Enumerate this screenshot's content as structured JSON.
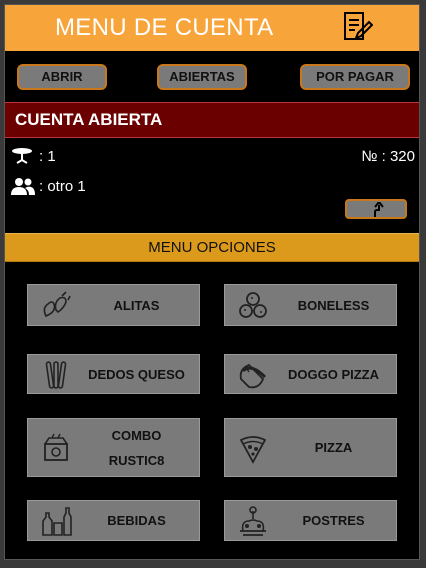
{
  "header": {
    "title": "MENU DE CUENTA"
  },
  "tabs": [
    {
      "label": "ABRIR"
    },
    {
      "label": "ABIERTAS"
    },
    {
      "label": "POR PAGAR"
    }
  ],
  "account": {
    "title": "CUENTA ABIERTA",
    "table": ": 1",
    "guest": ": otro 1",
    "number": "№  : 320"
  },
  "options": {
    "title": "MENU OPCIONES",
    "items": [
      {
        "label": "ALITAS",
        "icon": "wings-icon"
      },
      {
        "label": "BONELESS",
        "icon": "boneless-icon"
      },
      {
        "label": "DEDOS QUESO",
        "icon": "cheese-sticks-icon"
      },
      {
        "label": "DOGGO PIZZA",
        "icon": "hotdog-icon"
      },
      {
        "label": "COMBO",
        "label2": "RUSTIC8",
        "icon": "combo-icon"
      },
      {
        "label": "PIZZA",
        "icon": "pizza-slice-icon"
      },
      {
        "label": "BEBIDAS",
        "icon": "drinks-icon"
      },
      {
        "label": "POSTRES",
        "icon": "desserts-icon"
      }
    ]
  }
}
